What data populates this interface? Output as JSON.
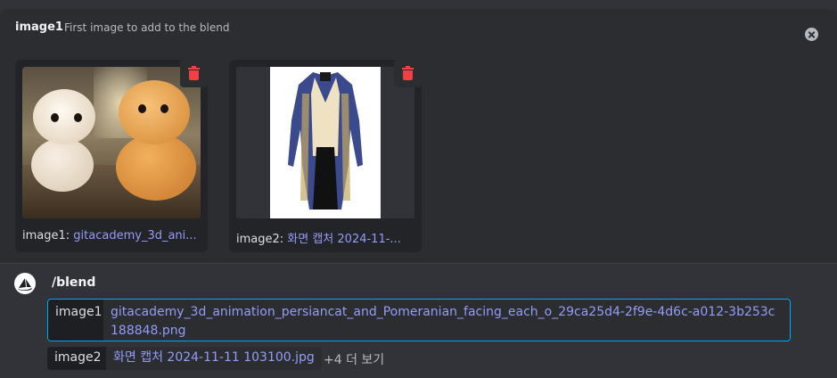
{
  "option_header": {
    "name": "image1",
    "description": "First image to add to the blend"
  },
  "uploads": [
    {
      "label": "image1:",
      "filename": "gitacademy_3d_ani..."
    },
    {
      "label": "image2:",
      "filename": "화면 캡처 2024-11-..."
    }
  ],
  "command": {
    "name": "/blend",
    "params": [
      {
        "name": "image1",
        "value": "gitacademy_3d_animation_persiancat_and_Pomeranian_facing_each_o_29ca25d4-2f9e-4d6c-a012-3b253c188848.png"
      },
      {
        "name": "image2",
        "value": "화면 캡처 2024-11-11 103100.jpg"
      }
    ],
    "more_label": "+4 더 보기"
  },
  "colors": {
    "accent_link": "#949cf7",
    "danger": "#f23f43",
    "focus_border": "#00a8fc"
  }
}
